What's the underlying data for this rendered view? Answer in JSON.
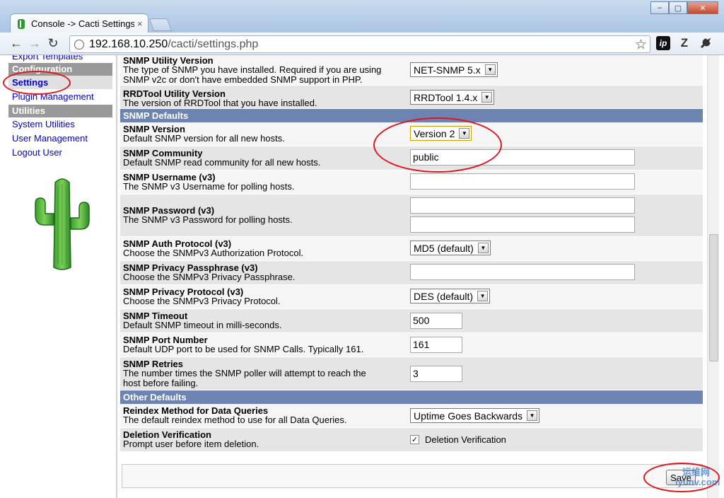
{
  "browser": {
    "tab_title": "Console -> Cacti Settings",
    "tab_close": "×",
    "url_host": "192.168.10.250",
    "url_path": "/cacti/settings.php",
    "window_controls": [
      "‒",
      "▢",
      "✕"
    ],
    "extensions": [
      "ip",
      "Z",
      "wrench-icon"
    ]
  },
  "sidebar": {
    "cut_item": "Export Templates",
    "config_head": "Configuration",
    "settings": "Settings",
    "plugin_management": "Plugin Management",
    "utilities_head": "Utilities",
    "system_utilities": "System Utilities",
    "user_management": "User Management",
    "logout_user": "Logout User"
  },
  "rows": {
    "snmp_utility": {
      "title": "SNMP Utility Version",
      "desc1": "The type of SNMP you have installed. Required if you are using",
      "desc2": "SNMP v2c or don't have embedded SNMP support in PHP.",
      "value": "NET-SNMP 5.x"
    },
    "rrdtool": {
      "title": "RRDTool Utility Version",
      "desc": "The version of RRDTool that you have installed.",
      "value": "RRDTool 1.4.x"
    },
    "section_snmp": "SNMP Defaults",
    "snmp_version": {
      "title": "SNMP Version",
      "desc": "Default SNMP version for all new hosts.",
      "value": "Version 2"
    },
    "snmp_community": {
      "title": "SNMP Community",
      "desc": "Default SNMP read community for all new hosts.",
      "value": "public"
    },
    "snmp_username": {
      "title": "SNMP Username (v3)",
      "desc": "The SNMP v3 Username for polling hosts.",
      "value": ""
    },
    "snmp_password": {
      "title": "SNMP Password (v3)",
      "desc": "The SNMP v3 Password for polling hosts.",
      "value": "",
      "confirm": ""
    },
    "snmp_auth": {
      "title": "SNMP Auth Protocol (v3)",
      "desc": "Choose the SNMPv3 Authorization Protocol.",
      "value": "MD5 (default)"
    },
    "snmp_priv_pass": {
      "title": "SNMP Privacy Passphrase (v3)",
      "desc": "Choose the SNMPv3 Privacy Passphrase.",
      "value": ""
    },
    "snmp_priv_proto": {
      "title": "SNMP Privacy Protocol (v3)",
      "desc": "Choose the SNMPv3 Privacy Protocol.",
      "value": "DES (default)"
    },
    "snmp_timeout": {
      "title": "SNMP Timeout",
      "desc": "Default SNMP timeout in milli-seconds.",
      "value": "500"
    },
    "snmp_port": {
      "title": "SNMP Port Number",
      "desc": "Default UDP port to be used for SNMP Calls. Typically 161.",
      "value": "161"
    },
    "snmp_retries": {
      "title": "SNMP Retries",
      "desc1": "The number times the SNMP poller will attempt to reach the",
      "desc2": "host before failing.",
      "value": "3"
    },
    "section_other": "Other Defaults",
    "reindex": {
      "title": "Reindex Method for Data Queries",
      "desc": "The default reindex method to use for all Data Queries.",
      "value": "Uptime Goes Backwards"
    },
    "deletion": {
      "title": "Deletion Verification",
      "desc": "Prompt user before item deletion.",
      "value": "Deletion Verification",
      "checked": true
    }
  },
  "save_label": "Save",
  "watermark": {
    "line1": "运维网",
    "line2": "iyunv.com"
  },
  "colors": {
    "section": "#6d84b3",
    "link": "#0000cc",
    "annotation": "#e0141c"
  }
}
